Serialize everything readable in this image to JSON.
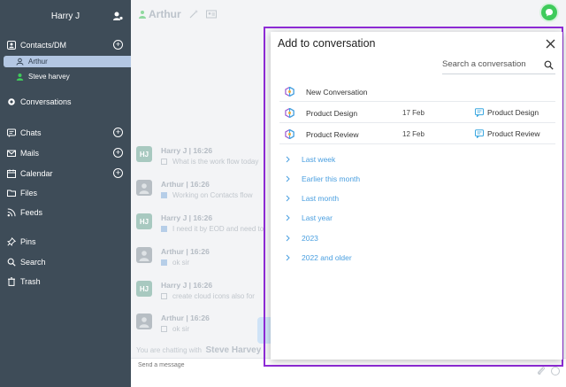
{
  "sidebar": {
    "user_name": "Harry J",
    "contacts_label": "Contacts/DM",
    "contacts": [
      {
        "name": "Arthur",
        "active": true
      },
      {
        "name": "Steve harvey",
        "active": false
      }
    ],
    "conversations_label": "Conversations",
    "chats_label": "Chats",
    "mails_label": "Mails",
    "calendar_label": "Calendar",
    "files_label": "Files",
    "feeds_label": "Feeds",
    "pins_label": "Pins",
    "search_label": "Search",
    "trash_label": "Trash"
  },
  "chat": {
    "title": "Arthur",
    "messages": [
      {
        "avatar": "HJ",
        "header": "Harry J  | 16:26",
        "text": "What is the work flow today"
      },
      {
        "avatar": "",
        "header": "Arthur | 16:26",
        "text": "Working on Contacts flow"
      },
      {
        "avatar": "HJ",
        "header": "Harry J  | 16:26",
        "text": "I need it by EOD and need to"
      },
      {
        "avatar": "",
        "header": "Arthur | 16:26",
        "text": "ok sir"
      },
      {
        "avatar": "HJ",
        "header": "Harry J  | 16:26",
        "text": "create cloud icons also for"
      },
      {
        "avatar": "",
        "header": "Arthur | 16:26",
        "text": "ok sir"
      }
    ],
    "footer_prefix": "You are chatting with",
    "footer_name": "Steve Harvey",
    "input_placeholder": "Send a message"
  },
  "modal": {
    "title": "Add to conversation",
    "search_placeholder": "Search a conversation",
    "conversations": [
      {
        "name": "New Conversation",
        "date": "",
        "type": ""
      },
      {
        "name": "Product Design",
        "date": "17 Feb",
        "type": "Product Design"
      },
      {
        "name": "Product Review",
        "date": "12 Feb",
        "type": "Product Review"
      }
    ],
    "groups": [
      "Last week",
      "Earlier this month",
      "Last month",
      "Last year",
      "2023",
      "2022 and older"
    ]
  },
  "colors": {
    "sidebar_bg": "#3e4c58",
    "accent_blue": "#4a9fe0",
    "modal_frame": "#8e2bd6",
    "online_green": "#3fcb5b"
  }
}
